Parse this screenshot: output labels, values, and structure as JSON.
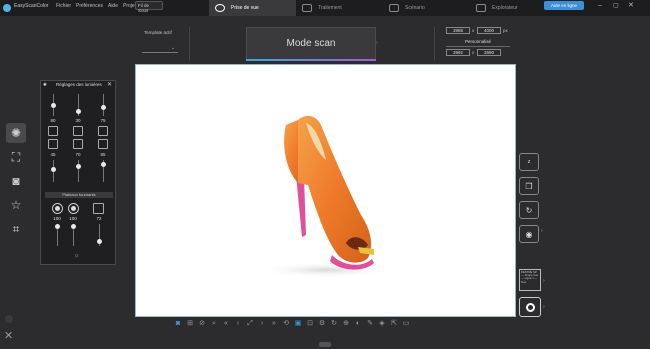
{
  "app": {
    "title": "EasyScanColor"
  },
  "menu": {
    "items": [
      "Fichier",
      "Préférences",
      "Aide",
      "Projets"
    ]
  },
  "project_select": {
    "value": "Fil de Sous"
  },
  "mode_tabs": [
    {
      "label": "Prise de vue",
      "icon": "eye-icon",
      "active": true
    },
    {
      "label": "Traitement",
      "icon": "treatment-icon",
      "active": false
    },
    {
      "label": "Scénario",
      "icon": "scenario-icon",
      "active": false
    },
    {
      "label": "Explorateur",
      "icon": "explorer-icon",
      "active": false
    }
  ],
  "online_button": {
    "label": "Aide en ligne"
  },
  "header": {
    "template_label": "Template actif",
    "mode_scan_label": "Mode scan",
    "width_value": "3988",
    "height_value": "4000",
    "size_unit": "px",
    "times_sign": "x",
    "preset_label": "Personnalisé",
    "width2_value": "3992",
    "height2_value": "3990"
  },
  "light_panel": {
    "title": "Réglages des lumières",
    "row1_values": [
      "80",
      "30",
      "75"
    ],
    "row2_values": [
      "45",
      "70",
      "85"
    ],
    "plateau_label": "Plateaux tournants",
    "row3_values": [
      "100",
      "100",
      "72"
    ]
  },
  "ticket_text": "DESTRE SP — Scope Vue — Ligne 1 — Text",
  "colors": {
    "accent": "#3b8fd4",
    "canvas_border": "#9fb4c4",
    "shoe": "#f07a2a",
    "sole": "#e0509a"
  }
}
